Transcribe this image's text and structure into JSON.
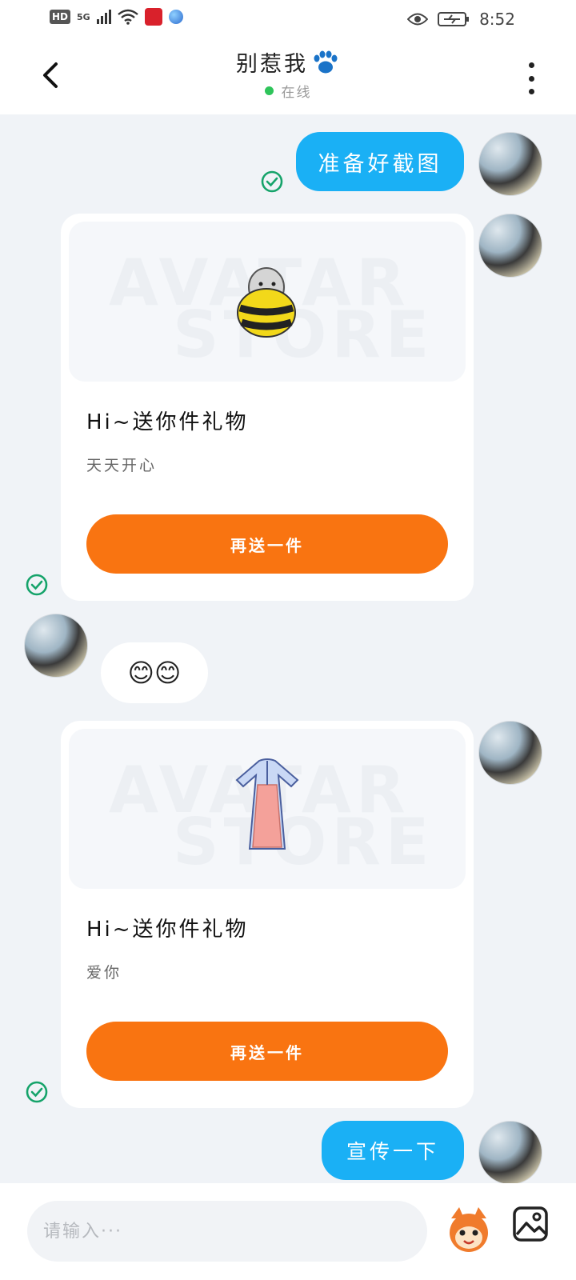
{
  "status_bar": {
    "hd": "HD",
    "network": "5G",
    "time": "8:52"
  },
  "header": {
    "title": "别惹我",
    "status": "在线",
    "icons": [
      "back-arrow-icon",
      "paw-icon",
      "more-vertical-icon"
    ]
  },
  "messages": {
    "m1": {
      "text": "准备好截图"
    },
    "m2": {
      "title": "Hi~送你件礼物",
      "message": "天天开心",
      "button": "再送一件",
      "watermark_1": "AVATAR",
      "watermark_2": "STORE"
    },
    "m3": {
      "text": "😊😊"
    },
    "m4": {
      "title": "Hi~送你件礼物",
      "message": "爱你",
      "button": "再送一件",
      "watermark_1": "AVATAR",
      "watermark_2": "STORE"
    },
    "m5": {
      "text": "宣传一下"
    }
  },
  "input": {
    "placeholder": "请输入···",
    "value": ""
  },
  "colors": {
    "bubble_blue": "#1ab0f5",
    "button_orange": "#f97411",
    "online_green": "#2ec45a",
    "check_green": "#15a36a",
    "background": "#f0f3f7"
  }
}
